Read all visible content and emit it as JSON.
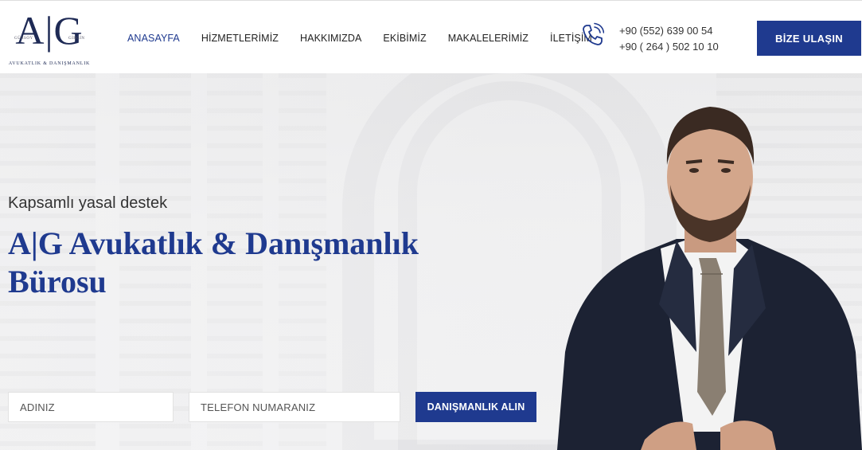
{
  "logo": {
    "monogram": "A|G",
    "left_small": "GÜRSOY",
    "right_small": "GİRGİN",
    "subtitle": "AVUKATLIK & DANIŞMANLIK"
  },
  "nav": {
    "items": [
      {
        "label": "ANASAYFA",
        "active": true
      },
      {
        "label": "HİZMETLERİMİZ",
        "active": false
      },
      {
        "label": "HAKKIMIZDA",
        "active": false
      },
      {
        "label": "EKİBİMİZ",
        "active": false
      },
      {
        "label": "MAKALELERİMİZ",
        "active": false
      },
      {
        "label": "İLETİŞİM",
        "active": false
      }
    ]
  },
  "contact": {
    "icon": "phone-icon",
    "phone1": "+90 (552) 639 00 54",
    "phone2": "+90 ( 264 ) 502 10 10"
  },
  "cta": {
    "label": "BİZE ULAŞIN"
  },
  "hero": {
    "tagline": "Kapsamlı yasal destek",
    "title": "A|G Avukatlık & Danışmanlık Bürosu"
  },
  "form": {
    "name_placeholder": "ADINIZ",
    "phone_placeholder": "TELEFON NUMARANIZ",
    "submit_label": "DANIŞMANLIK ALIN"
  },
  "colors": {
    "brand": "#1f3a8f",
    "logo": "#1e2a55"
  }
}
